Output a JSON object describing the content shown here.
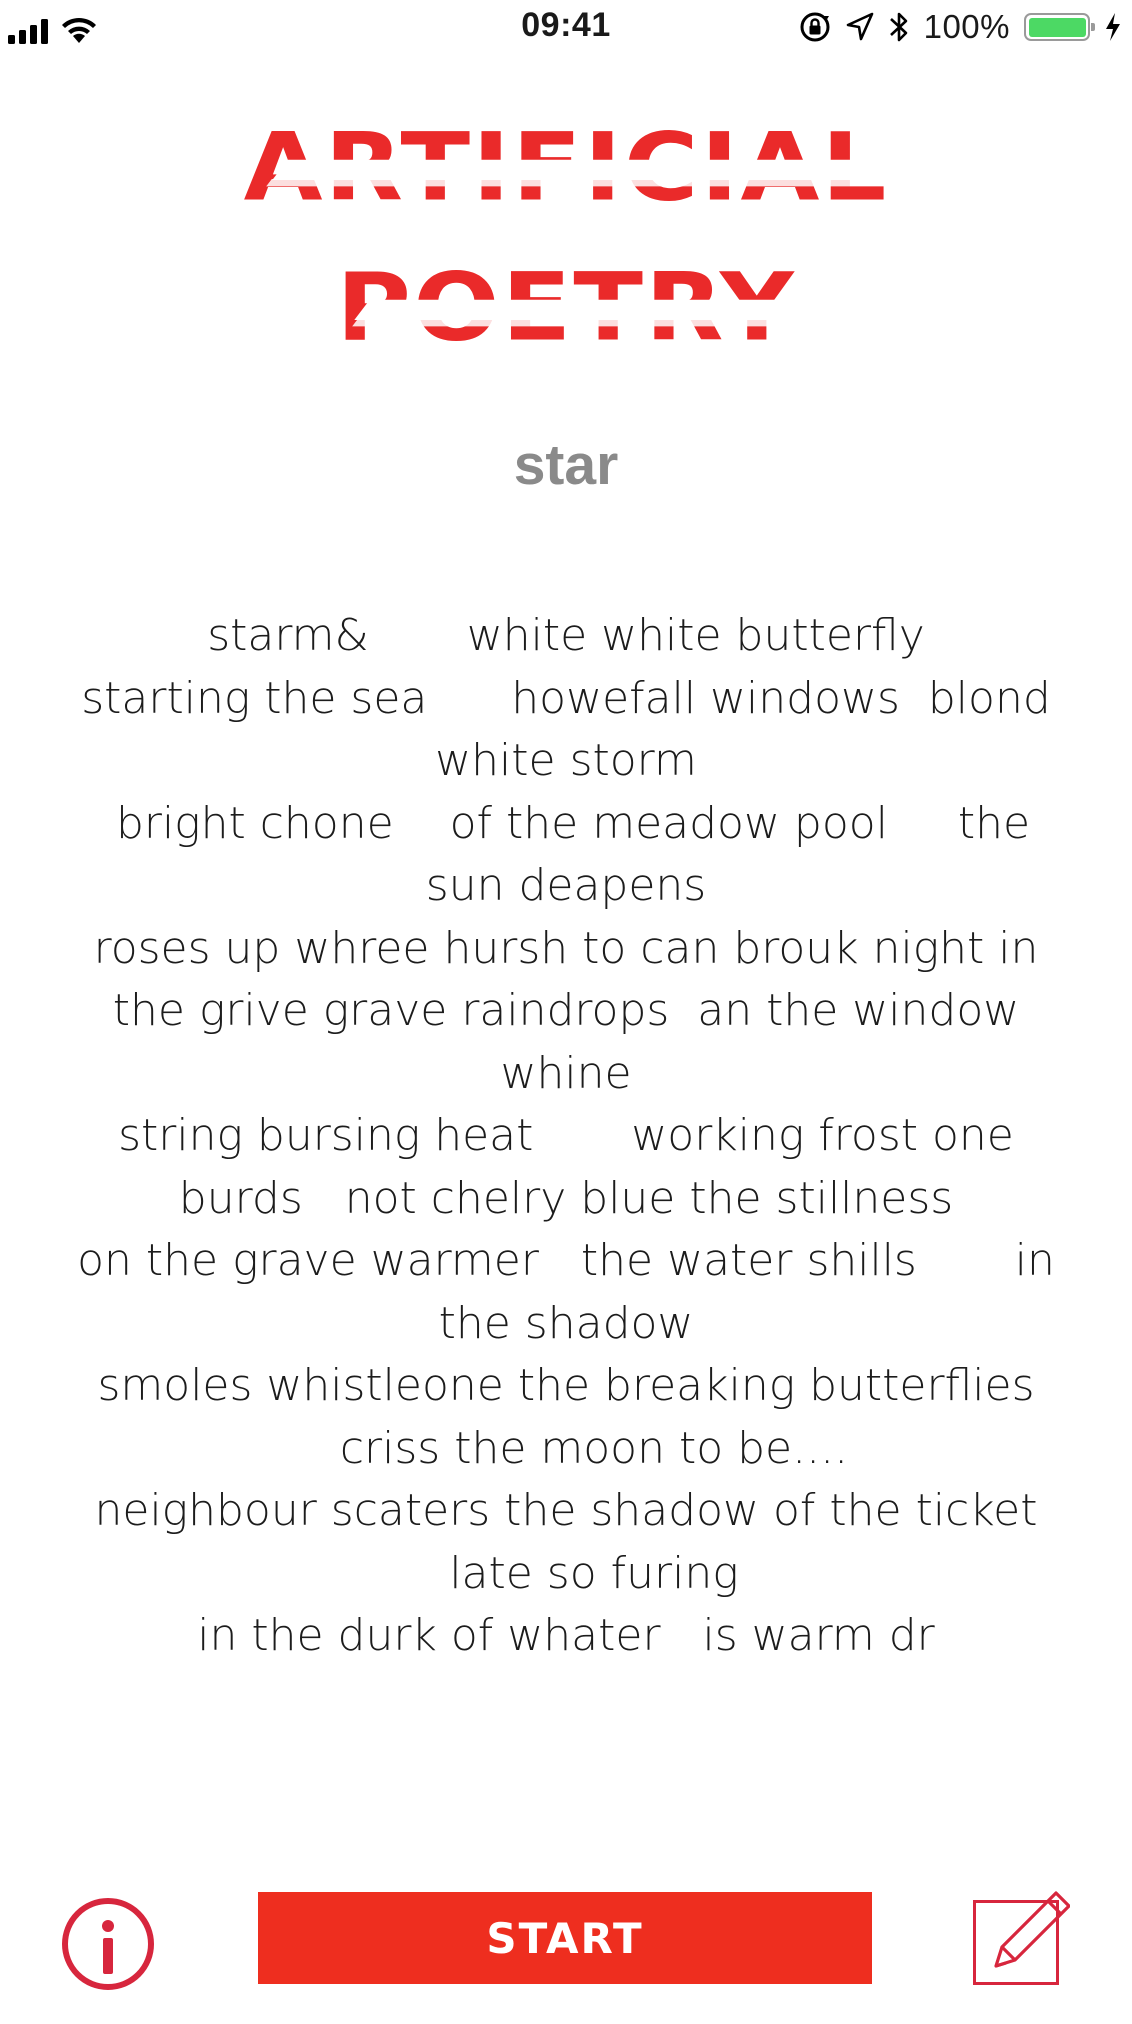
{
  "status_bar": {
    "time": "09:41",
    "battery_percent": "100%",
    "battery_level": 1.0,
    "icons": [
      "signal-icon",
      "wifi-icon",
      "rotation-lock-icon",
      "location-icon",
      "bluetooth-icon",
      "battery-icon",
      "charging-icon"
    ]
  },
  "logo": {
    "line1": "ARTIFICIAL",
    "line2": "POETRY"
  },
  "keyword": "star",
  "poem": {
    "lines": [
      "starm&       white white butterfly",
      "starting the sea      howefall windows  blond",
      "white storm",
      " bright chone    of the meadow pool     the",
      "sun deapens",
      "roses up whree hursh to can brouk night in",
      "the grive grave raindrops  an the window",
      "whine",
      "string bursing heat       working frost one",
      "burds   not chelry blue the stillness",
      "on the grave warmer   the water shills       in",
      "the shadow",
      "smoles whistleone the breaking butterflies",
      "    criss the moon to be....",
      "neighbour scaters the shadow of the ticket",
      "    late so furing",
      "in the durk of whater   is warm dr"
    ]
  },
  "bottom_bar": {
    "start_label": "START",
    "info_icon": "info-icon",
    "edit_icon": "edit-icon"
  },
  "colors": {
    "accent": "#ee2e1f",
    "logo": "#ea2a2a",
    "info_ring": "#d7263d",
    "keyword": "#8a8a8a",
    "battery_fill": "#4cd964"
  }
}
